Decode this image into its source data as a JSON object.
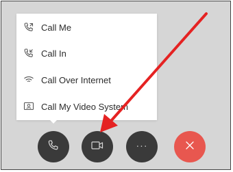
{
  "call_options_menu": {
    "items": [
      {
        "label": "Call Me",
        "icon": "phone-outgoing-icon"
      },
      {
        "label": "Call In",
        "icon": "phone-incoming-icon"
      },
      {
        "label": "Call Over Internet",
        "icon": "wifi-icon"
      },
      {
        "label": "Call My Video System",
        "icon": "video-system-icon"
      }
    ]
  },
  "controls": {
    "audio": {
      "icon": "phone-icon"
    },
    "video": {
      "icon": "video-camera-icon"
    },
    "more": {
      "icon": "ellipsis-icon",
      "label": "···"
    },
    "leave": {
      "icon": "close-icon"
    }
  },
  "colors": {
    "background": "#d6d6d6",
    "control_dark": "#3a3a3a",
    "leave_red": "#e8574f",
    "annotation_arrow": "#e52222"
  }
}
